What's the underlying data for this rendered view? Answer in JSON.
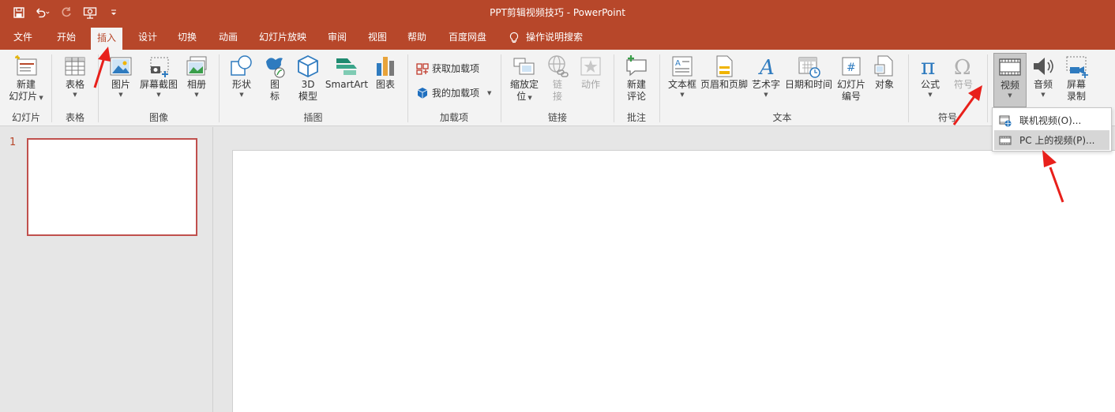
{
  "window": {
    "title": "PPT剪辑视频技巧  -  PowerPoint"
  },
  "qat": {
    "icons": [
      "save-icon",
      "undo-icon",
      "redo-icon",
      "present-icon",
      "customize-icon"
    ]
  },
  "tabs": [
    "文件",
    "开始",
    "插入",
    "设计",
    "切换",
    "动画",
    "幻灯片放映",
    "审阅",
    "视图",
    "帮助",
    "百度网盘",
    "操作说明搜索"
  ],
  "active_tab": "插入",
  "ribbon": {
    "groups": [
      "幻灯片",
      "表格",
      "图像",
      "插图",
      "加载项",
      "链接",
      "批注",
      "文本",
      "符号"
    ],
    "buttons": {
      "new_slide": [
        "新建",
        "幻灯片"
      ],
      "table": "表格",
      "pictures": "图片",
      "screenshot": "屏幕截图",
      "album": "相册",
      "shapes": "形状",
      "icons": [
        "图",
        "标"
      ],
      "model3d": [
        "3D",
        "模型"
      ],
      "smartart": "SmartArt",
      "chart": "图表",
      "get_addins": "获取加载项",
      "my_addins": "我的加载项",
      "zoom": [
        "缩放定",
        "位"
      ],
      "link": [
        "链",
        "接"
      ],
      "action": "动作",
      "new_comment": [
        "新建",
        "评论"
      ],
      "textbox": "文本框",
      "header_footer": "页眉和页脚",
      "wordart": "艺术字",
      "datetime": "日期和时间",
      "slide_number": [
        "幻灯片",
        "编号"
      ],
      "object": "对象",
      "equation": "公式",
      "symbol": "符号",
      "video": "视频",
      "audio": "音频",
      "screen_recording": [
        "屏幕",
        "录制"
      ]
    }
  },
  "video_menu": {
    "items": [
      {
        "label": "联机视频(O)...",
        "icon": "online-video-icon"
      },
      {
        "label": "PC 上的视频(P)...",
        "icon": "film-icon"
      }
    ]
  },
  "slides_pane": {
    "slide_number": "1"
  },
  "colors": {
    "accent": "#b7472a",
    "arrow": "#e8201b"
  }
}
